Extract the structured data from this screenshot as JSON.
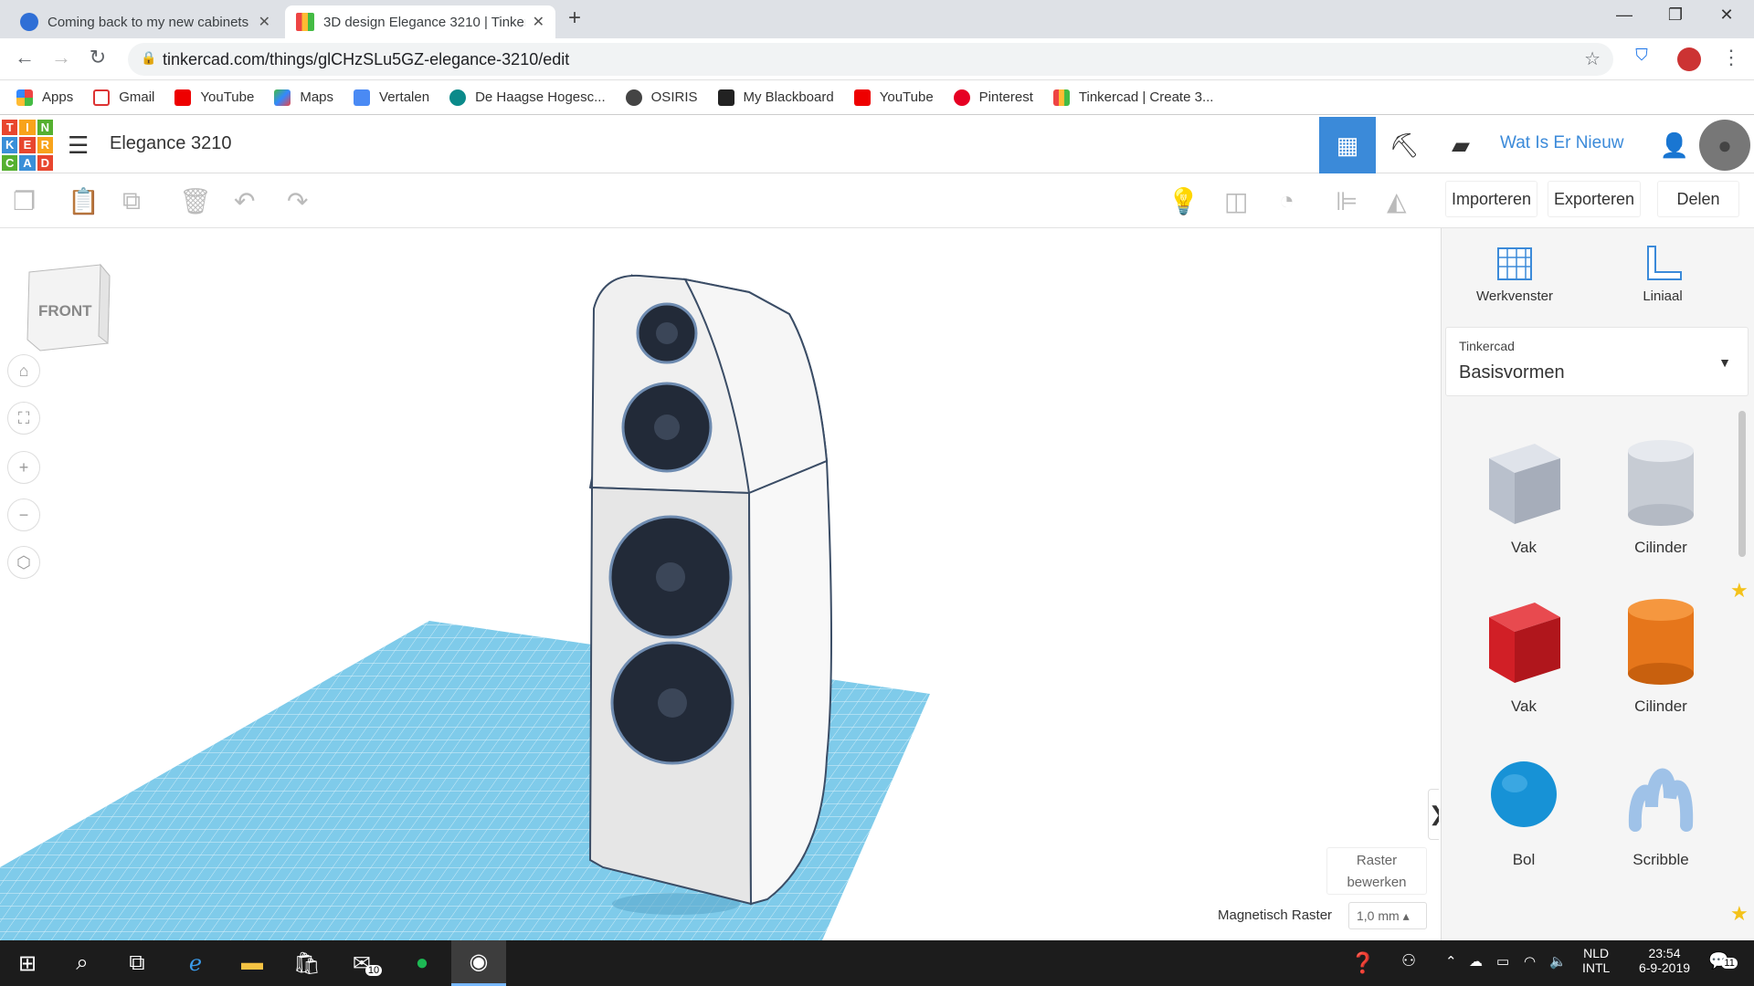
{
  "browser": {
    "tabs": [
      {
        "title": "Coming back to my new cabinets",
        "favicon": "wave-icon"
      },
      {
        "title": "3D design Elegance 3210 | Tinkercad",
        "favicon": "tinkercad-icon"
      }
    ],
    "new_tab": "+",
    "url": "tinkercad.com/things/glCHzSLu5GZ-elegance-3210/edit",
    "bookmarks": [
      "Apps",
      "Gmail",
      "YouTube",
      "Maps",
      "Vertalen",
      "De Haagse Hogesc...",
      "OSIRIS",
      "My Blackboard",
      "YouTube",
      "Pinterest",
      "Tinkercad | Create 3..."
    ]
  },
  "header": {
    "logo_letters": [
      "T",
      "I",
      "N",
      "K",
      "E",
      "R",
      "C",
      "A",
      "D"
    ],
    "design_title": "Elegance 3210",
    "whats_new": "Wat Is Er Nieuw"
  },
  "toolbar": {
    "import": "Importeren",
    "export": "Exporteren",
    "share": "Delen"
  },
  "workplane": {
    "viewcube_label": "FRONT",
    "raster_edit_line1": "Raster",
    "raster_edit_line2": "bewerken",
    "magnet_label": "Magnetisch Raster",
    "magnet_value": "1,0 mm"
  },
  "panel": {
    "workplane_btn": "Werkvenster",
    "ruler_btn": "Liniaal",
    "category_small": "Tinkercad",
    "category": "Basisvormen",
    "shapes": [
      {
        "label": "Vak",
        "color": "#b9c0cc",
        "kind": "box-hole"
      },
      {
        "label": "Cilinder",
        "color": "#c7ccd4",
        "kind": "cyl-hole"
      },
      {
        "label": "Vak",
        "color": "#d11f26",
        "kind": "box"
      },
      {
        "label": "Cilinder",
        "color": "#e6761b",
        "kind": "cyl"
      },
      {
        "label": "Bol",
        "color": "#1792d6",
        "kind": "sphere"
      },
      {
        "label": "Scribble",
        "color": "#9fc2e8",
        "kind": "scribble"
      }
    ]
  },
  "taskbar": {
    "mail_badge": "10",
    "lang_line1": "NLD",
    "lang_line2": "INTL",
    "time": "23:54",
    "date": "6-9-2019",
    "notif_badge": "11"
  }
}
